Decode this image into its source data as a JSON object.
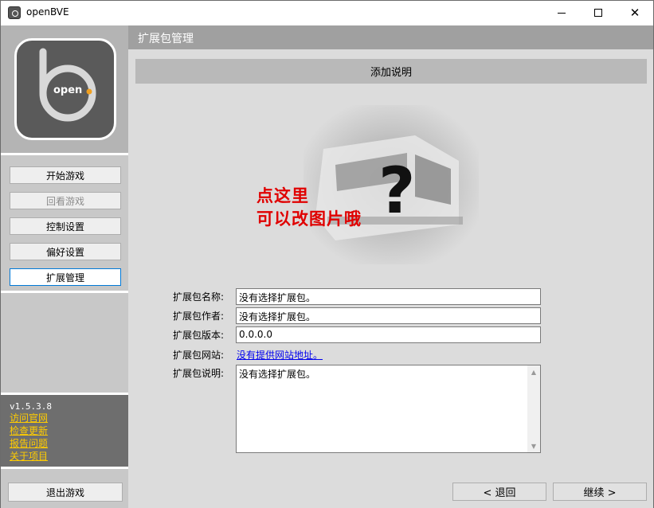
{
  "window": {
    "title": "openBVE"
  },
  "sidebar": {
    "logo_text": "open",
    "buttons": [
      {
        "label": "开始游戏",
        "state": "normal"
      },
      {
        "label": "回看游戏",
        "state": "disabled"
      },
      {
        "label": "控制设置",
        "state": "normal"
      },
      {
        "label": "偏好设置",
        "state": "normal"
      },
      {
        "label": "扩展管理",
        "state": "active"
      }
    ],
    "version": "v1.5.3.8",
    "links": [
      "访问官网",
      "检查更新",
      "报告问题",
      "关于项目"
    ],
    "exit_label": "退出游戏"
  },
  "main": {
    "header": "扩展包管理",
    "subheader": "添加说明",
    "preview_overlay": [
      "点这里",
      "可以改图片哦"
    ],
    "fields": {
      "name_label": "扩展包名称:",
      "name_value": "没有选择扩展包。",
      "author_label": "扩展包作者:",
      "author_value": "没有选择扩展包。",
      "version_label": "扩展包版本:",
      "version_value": "0.0.0.0",
      "website_label": "扩展包网站:",
      "website_value": "没有提供网站地址。",
      "description_label": "扩展包说明:",
      "description_value": "没有选择扩展包。"
    },
    "back_label": "< 退回",
    "next_label": "继续 >"
  },
  "colors": {
    "sidebar_bg": "#c8c8c8",
    "header_bg": "#a0a0a0",
    "version_bg": "#6e6e6e",
    "link_yellow": "#ffcc00",
    "overlay_red": "#e00000"
  }
}
